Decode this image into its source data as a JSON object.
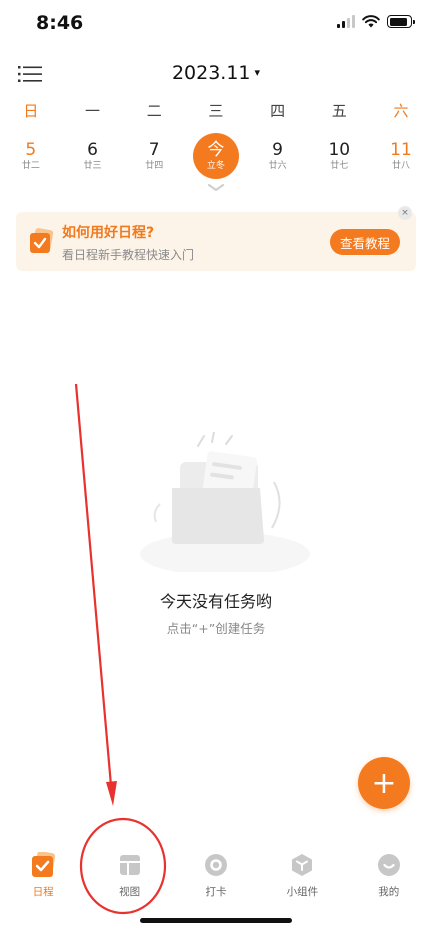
{
  "status_bar": {
    "time": "8:46",
    "battery_level": 0.85
  },
  "header": {
    "month": "2023.11",
    "month_caret": "▾"
  },
  "weekdays": [
    "日",
    "一",
    "二",
    "三",
    "四",
    "五",
    "六"
  ],
  "dates": [
    {
      "day": "5",
      "lunar": "廿二"
    },
    {
      "day": "6",
      "lunar": "廿三"
    },
    {
      "day": "7",
      "lunar": "廿四"
    },
    {
      "day": "今",
      "lunar": "立冬"
    },
    {
      "day": "9",
      "lunar": "廿六"
    },
    {
      "day": "10",
      "lunar": "廿七"
    },
    {
      "day": "11",
      "lunar": "廿八"
    }
  ],
  "tip": {
    "title": "如何用好日程?",
    "subtitle": "看日程新手教程快速入门",
    "button": "查看教程",
    "close": "×"
  },
  "empty": {
    "title": "今天没有任务哟",
    "subtitle": "点击“+”创建任务"
  },
  "fab": {
    "label": "+"
  },
  "tabs": [
    {
      "label": "日程",
      "icon": "schedule-icon",
      "active": true
    },
    {
      "label": "视图",
      "icon": "view-icon",
      "active": false
    },
    {
      "label": "打卡",
      "icon": "checkin-icon",
      "active": false
    },
    {
      "label": "小组件",
      "icon": "widget-icon",
      "active": false
    },
    {
      "label": "我的",
      "icon": "profile-icon",
      "active": false
    }
  ],
  "colors": {
    "accent": "#f47a1f",
    "annotation_red": "#e8322e"
  }
}
